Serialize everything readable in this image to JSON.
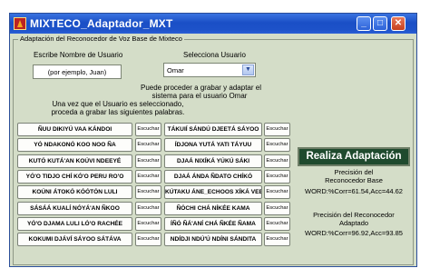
{
  "window": {
    "title": "MIXTECO_Adaptador_MXT"
  },
  "panel": {
    "legend": "Adaptación del Reconocedor de Voz Base de Mixteco"
  },
  "user_name": {
    "label": "Escribe Nombre de Usuario",
    "value": "(por ejemplo, Juan)"
  },
  "user_select": {
    "label": "Selecciona Usuario",
    "selected": "Omar"
  },
  "messages": {
    "line1": "Puede proceder a grabar y adaptar el",
    "line2": "sistema para el usuario Omar",
    "line3": "Una vez que el Usuario es seleccionado,",
    "line4": "proceda a grabar las siguientes palabras."
  },
  "record_label": "Escuchar",
  "words_left": [
    "ÑUU DIKIYÚ VAA KÁNDOI",
    "YÓ NDAKONÓ KOO NOO ÑA",
    "KUTÓ KUTÁ'AN KOÚVI NDEEYÉ",
    "YÓ'O TIDJO CHÍ KÓ'O PERU RO'O",
    "KOÚNI ÁTOKÓ KÓÓTÓN LULI",
    "SÁSÁÁ KUALÍ NÓYÁ'AN ÑKOO",
    "YÓ'O DJAMA LULI LÓ'O RACHÉE",
    "KOKUMI DJÁVÍ SÁYOO SÁTÁVA"
  ],
  "words_right": [
    "TÁKUIÍ SÁNDÚ DJEETÁ SÁYOO",
    "ÍDJONA YUTÁ YATI TÁYUU",
    "DJAÁ NIXÍKÁ YÚKÚ SÁKI",
    "DJAÁ ÁNDA ÑDATO CHÍKÓ",
    "KÚTAKU ÁNE_ECHOOS XÍKÁ VEE",
    "ÑÓCHI CHÁ NÍKÉE KAMA",
    "ÍÑÓ ÑÁ'ANÍ CHÁ ÑKÉE ÑAMA",
    "NDÍDJI NDÚ'Ú NDÍNI SÁNDITA"
  ],
  "adapt_button": "Realiza Adaptación",
  "results": {
    "base_title_1": "Precisión del",
    "base_title_2": "Reconocedor Base",
    "base_metrics": "WORD:%Corr=61.54,Acc=44.62",
    "adapted_title_1": "Precisión del Reconocedor",
    "adapted_title_2": "Adaptado",
    "adapted_metrics": "WORD:%Corr=96.92,Acc=93.85"
  }
}
